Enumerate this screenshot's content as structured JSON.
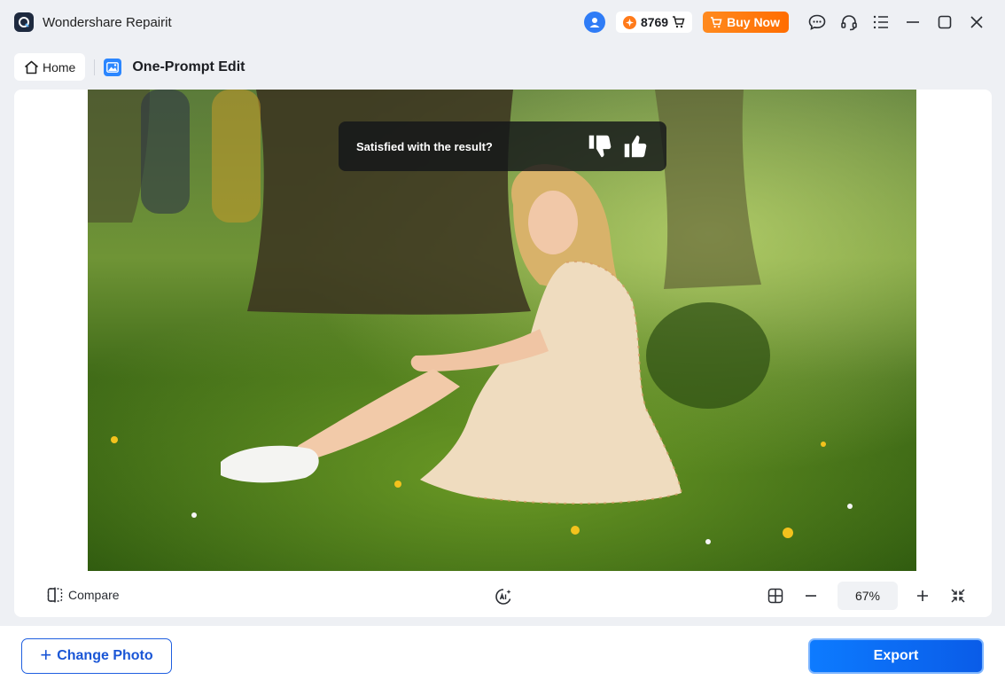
{
  "window": {
    "title": "Wondershare Repairit",
    "credits": "8769",
    "buy_now_label": "Buy Now"
  },
  "nav": {
    "home_label": "Home",
    "tool_title": "One-Prompt Edit"
  },
  "feedback": {
    "question": "Satisfied with the result?"
  },
  "toolbar": {
    "compare_label": "Compare",
    "zoom_value": "67%"
  },
  "footer": {
    "change_photo_label": "Change Photo",
    "export_label": "Export"
  },
  "icons": {
    "app": "repairit-logo-icon",
    "account": "user-avatar-icon",
    "coin": "coin-icon",
    "cart": "cart-icon",
    "chat": "chat-icon",
    "support": "headset-icon",
    "menu": "menu-list-icon",
    "minimize": "minimize-icon",
    "maximize": "maximize-icon",
    "close": "close-icon",
    "home": "home-icon",
    "tool": "image-edit-icon",
    "dislike": "thumbs-down-icon",
    "like": "thumbs-up-icon",
    "compare": "compare-icon",
    "ai": "ai-edit-icon",
    "grid": "grid-icon",
    "zoom_out": "minus-icon",
    "zoom_in": "plus-icon",
    "fit": "fit-screen-icon"
  },
  "colors": {
    "accent": "#0d6efd",
    "buy_now": "#ff7a00",
    "coin": "#ff7a1a",
    "tool_icon": "#2b86ff"
  }
}
